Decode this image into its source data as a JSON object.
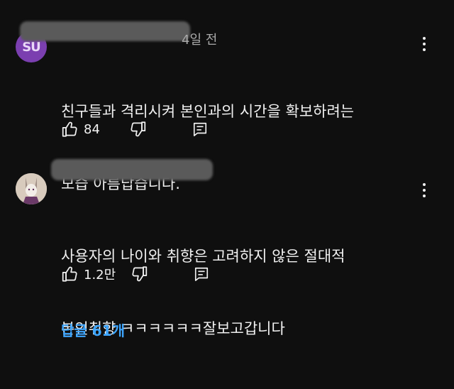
{
  "comments": [
    {
      "avatar_initials": "SU",
      "avatar_color": "#7b3fb0",
      "time": "4일 전",
      "text_lines": [
        "친구들과 격리시켜 본인과의 시간을 확보하려는",
        "모습 아름답습니다."
      ],
      "likes": "84",
      "icons": {
        "like": "thumbs-up-icon",
        "dislike": "thumbs-down-icon",
        "reply": "reply-icon",
        "more": "more-vert-icon"
      }
    },
    {
      "avatar_icon": "character-avatar",
      "text_lines": [
        "사용자의 나이와 취향은 고려하지 않은 절대적",
        "본인취향 ㅋㅋㅋㅋㅋㅋ잘보고갑니다"
      ],
      "likes": "1.2만",
      "icons": {
        "like": "thumbs-up-icon",
        "dislike": "thumbs-down-icon",
        "reply": "reply-icon",
        "more": "more-vert-icon"
      }
    }
  ],
  "replies_label": "답글 61개",
  "colors": {
    "background": "#0f0f0f",
    "text": "#f1f1f1",
    "secondary": "#aaaaaa",
    "link": "#3ea6ff"
  }
}
